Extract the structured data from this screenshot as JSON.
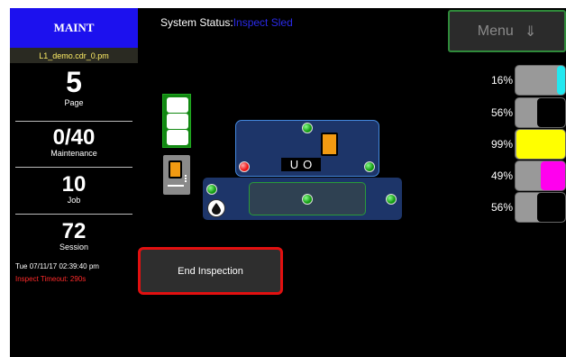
{
  "sidebar": {
    "mode": "MAINT",
    "file": "L1_demo.cdr_0.pm",
    "stats": [
      {
        "value": "5",
        "label": "Page"
      },
      {
        "value": "0/40",
        "label": "Maintenance"
      },
      {
        "value": "10",
        "label": "Job"
      },
      {
        "value": "72",
        "label": "Session"
      }
    ],
    "datetime": "Tue 07/11/17 02:39:40 pm",
    "timeout": "Inspect Timeout: 290s"
  },
  "status": {
    "label": "System Status:",
    "value": "Inspect Sled"
  },
  "menu": {
    "label": "Menu",
    "icon": "down-arrow-icon",
    "arrow": "⇓"
  },
  "inks": [
    {
      "percent_text": "16%",
      "level": 0.16,
      "color": "#22e8f0"
    },
    {
      "percent_text": "56%",
      "level": 0.56,
      "color": "#000000"
    },
    {
      "percent_text": "99%",
      "level": 0.99,
      "color": "#ffff00"
    },
    {
      "percent_text": "49%",
      "level": 0.49,
      "color": "#ff00ee"
    },
    {
      "percent_text": "56%",
      "level": 0.56,
      "color": "#000000"
    }
  ],
  "diagram": {
    "slot_glyph_a": "U",
    "slot_glyph_b": "O"
  },
  "end_button": {
    "label": "End Inspection"
  },
  "colors": {
    "mode_bg": "#1c11ee",
    "status_value": "#2a2ae8",
    "alert": "#e21010",
    "menu_border": "#2f8a3a"
  }
}
